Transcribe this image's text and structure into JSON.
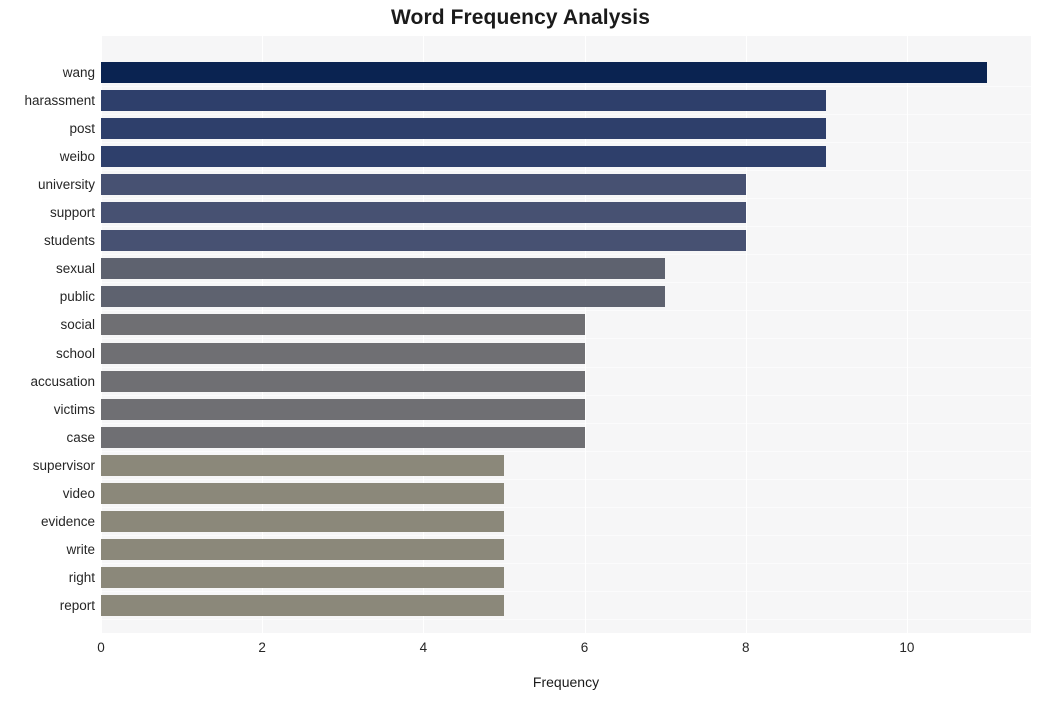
{
  "chart_data": {
    "type": "bar",
    "orientation": "horizontal",
    "title": "Word Frequency Analysis",
    "xlabel": "Frequency",
    "ylabel": "",
    "categories": [
      "wang",
      "harassment",
      "post",
      "weibo",
      "university",
      "support",
      "students",
      "sexual",
      "public",
      "social",
      "school",
      "accusation",
      "victims",
      "case",
      "supervisor",
      "video",
      "evidence",
      "write",
      "right",
      "report"
    ],
    "values": [
      11,
      9,
      9,
      9,
      8,
      8,
      8,
      7,
      7,
      6,
      6,
      6,
      6,
      6,
      5,
      5,
      5,
      5,
      5,
      5
    ],
    "bar_colors": [
      "#0a2351",
      "#2e3f6b",
      "#2e3f6b",
      "#2e3f6b",
      "#475172",
      "#475172",
      "#475172",
      "#5e626f",
      "#5e626f",
      "#6f6f73",
      "#6f6f73",
      "#6f6f73",
      "#6f6f73",
      "#6f6f73",
      "#8b887a",
      "#8b887a",
      "#8b887a",
      "#8b887a",
      "#8b887a",
      "#8b887a"
    ],
    "xticks": [
      0,
      2,
      4,
      6,
      8,
      10
    ],
    "xtick_labels": [
      "0",
      "2",
      "4",
      "6",
      "8",
      "10"
    ],
    "xlim": [
      0,
      11.54
    ],
    "grid": true,
    "legend": null,
    "plot_background": "#f6f6f7",
    "gridline_color": "#ffffff",
    "figure_background": "#ffffff",
    "title_color": "#1a1a1a"
  }
}
